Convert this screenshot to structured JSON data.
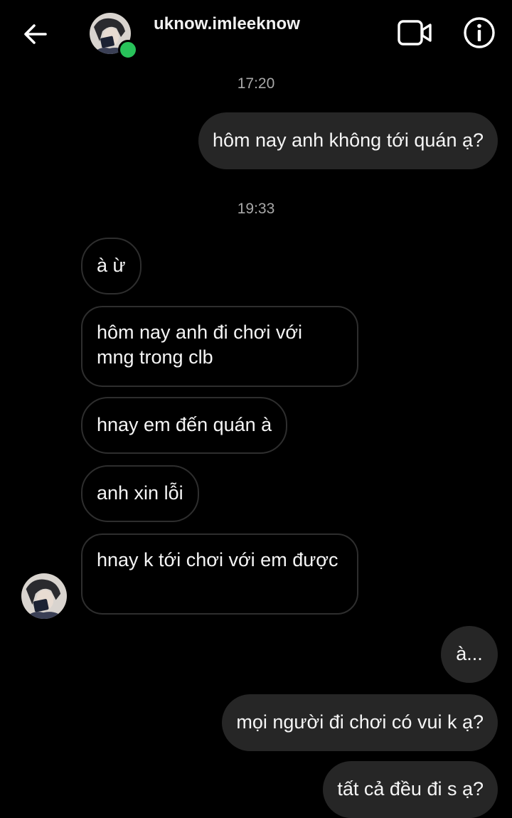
{
  "header": {
    "username": "uknow.imleeknow",
    "back_icon": "arrow-left-icon",
    "video_icon": "video-camera-icon",
    "info_icon": "info-icon",
    "online_color": "#28c25a"
  },
  "messages": {
    "timestamp_1": "17:20",
    "out_1": "hôm nay anh không tới quán ạ?",
    "timestamp_2": "19:33",
    "in_1": "à ừ",
    "in_2": "hôm nay anh đi chơi với mng trong clb",
    "in_3": "hnay em đến quán à",
    "in_4": "anh xin lỗi",
    "in_5": "hnay k tới chơi với em được",
    "out_2": "à...",
    "out_3": "mọi người đi chơi có vui k ạ?",
    "out_4": "tất cả đều đi s ạ?"
  },
  "colors": {
    "background": "#000000",
    "outgoing_bubble": "#262626",
    "incoming_border": "#2e2e2e",
    "timestamp": "#a8a8a8"
  }
}
